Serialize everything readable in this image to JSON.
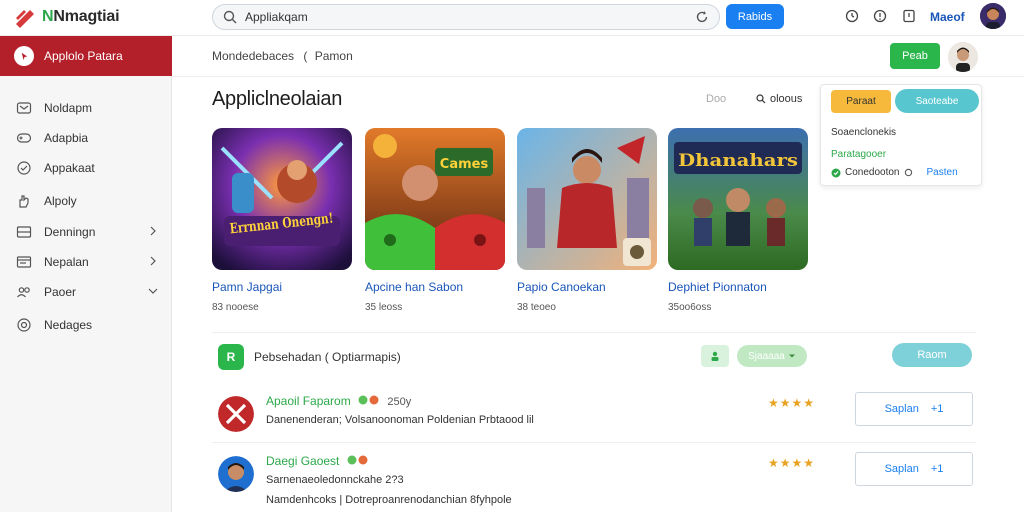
{
  "app": {
    "logo_text_accent": "N",
    "logo_text": "Nmagtiai"
  },
  "search": {
    "value": "Appliakqam",
    "button_label": "Rabids"
  },
  "topbar": {
    "link_label": "Maeof",
    "icons": [
      "clock-icon",
      "help-icon",
      "notification-icon"
    ]
  },
  "sidebar": {
    "active_label": "Applolo Patara",
    "items": [
      {
        "label": "Noldapm",
        "icon": "wallet-icon",
        "chevron": false
      },
      {
        "label": "Adapbia",
        "icon": "gamepad-icon",
        "chevron": false
      },
      {
        "label": "Appakaat",
        "icon": "check-circle-icon",
        "chevron": false
      },
      {
        "label": "Alpoly",
        "icon": "hand-icon",
        "chevron": false
      },
      {
        "label": "Denningn",
        "icon": "box-icon",
        "chevron": true
      },
      {
        "label": "Nepalan",
        "icon": "window-icon",
        "chevron": true
      },
      {
        "label": "Paoer",
        "icon": "people-icon",
        "chevron": true
      },
      {
        "label": "Nedages",
        "icon": "target-icon",
        "chevron": false
      }
    ]
  },
  "header": {
    "breadcrumb_main": "Mondedebaces",
    "breadcrumb_sep": "(",
    "breadcrumb_sub": "Pamon",
    "action_label": "Peab"
  },
  "section": {
    "title": "Appliclneolaian",
    "filter_label": "Doo",
    "sort_label": "oloous"
  },
  "panel": {
    "btn1_label": "Paraat",
    "btn2_label": "Saoteabe",
    "line1": "Soaenclonekis",
    "line2": "Paratagooer",
    "line3": "Conedooton",
    "line3_link": "Pasten"
  },
  "cards": [
    {
      "name": "Pamn Japgai",
      "meta": "83 nooese",
      "art": "Errnnan Onengn!"
    },
    {
      "name": "Apcine han Sabon",
      "meta": "35 leoss",
      "art": "Cames"
    },
    {
      "name": "Papio Canoekan",
      "meta": "38 teoeo",
      "art": ""
    },
    {
      "name": "Dephiet Pionnaton",
      "meta": "35oo6oss",
      "art": "Dhanahars"
    }
  ],
  "list": {
    "header_icon": "R",
    "header_title": "Pebsehadan ( Optiarmapis)",
    "btn_mid_label": "Sjaaaaa",
    "btn_right_label": "Raom",
    "rows": [
      {
        "name": "Apaoil Faparom",
        "extra": "250y",
        "sub": "Danenenderan; Volsanoonoman Poldenian Prbtaood lil",
        "sub2": "",
        "stars": "★★★★",
        "btn_label": "Saplan",
        "btn_icon": "+1"
      },
      {
        "name": "Daegi Gaoest",
        "extra": "",
        "sub": "Sarnenaeoledonnckahe 2?3",
        "sub2": "Namdenhcoks | Dotreproanrenodanchian 8fyhpole",
        "stars": "★★★★",
        "btn_label": "Saplan",
        "btn_icon": "+1"
      }
    ]
  },
  "colors": {
    "brand_red": "#b3202a",
    "accent_blue": "#1a7ff0",
    "accent_green": "#2bb64b",
    "star": "#e8a323"
  }
}
